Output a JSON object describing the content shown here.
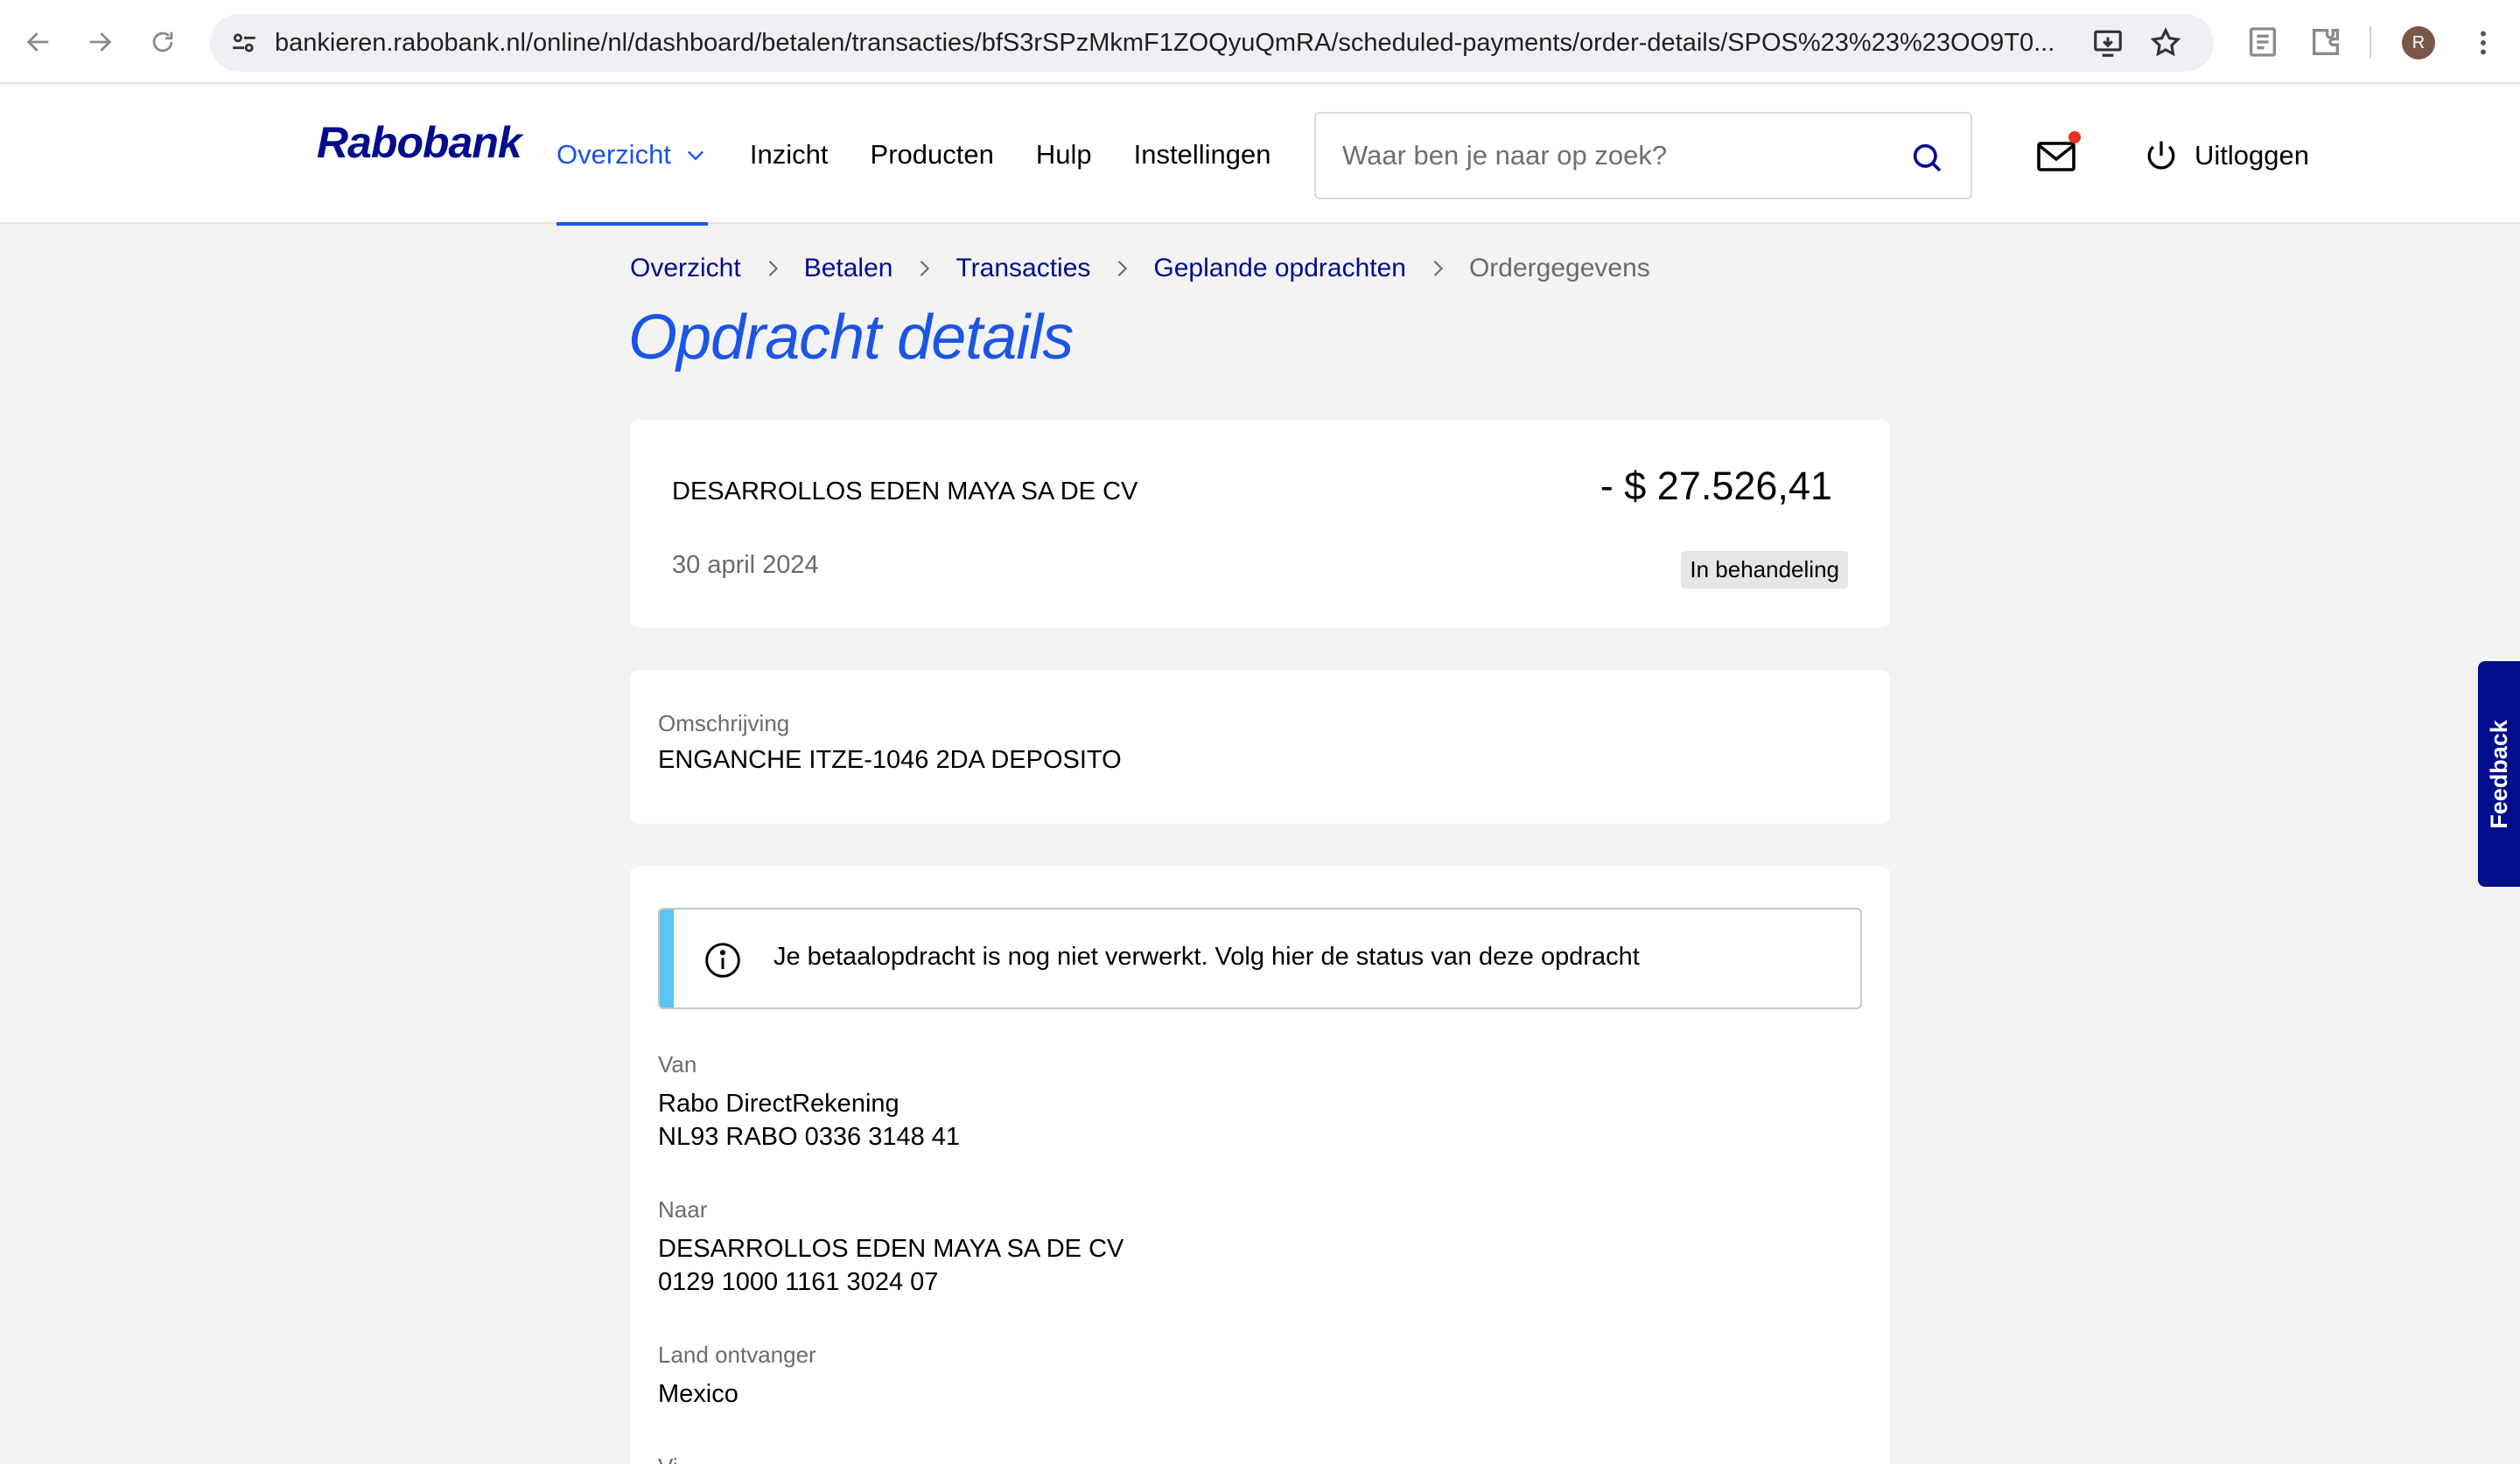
{
  "browser": {
    "url": "bankieren.rabobank.nl/online/nl/dashboard/betalen/transacties/bfS3rSPzMkmF1ZOQyuQmRA/scheduled-payments/order-details/SPOS%23%23%23OO9T0...",
    "profile_initial": "R"
  },
  "header": {
    "logo": "Rabobank",
    "nav": [
      {
        "label": "Overzicht",
        "active": true
      },
      {
        "label": "Inzicht"
      },
      {
        "label": "Producten"
      },
      {
        "label": "Hulp"
      },
      {
        "label": "Instellingen"
      }
    ],
    "search_placeholder": "Waar ben je naar op zoek?",
    "logout_label": "Uitloggen"
  },
  "breadcrumb": [
    "Overzicht",
    "Betalen",
    "Transacties",
    "Geplande opdrachten",
    "Ordergegevens"
  ],
  "title": "Opdracht details",
  "summary": {
    "payee": "DESARROLLOS EDEN MAYA SA DE CV",
    "amount": "- $ 27.526,41",
    "date": "30 april 2024",
    "status": "In behandeling"
  },
  "description": {
    "label": "Omschrijving",
    "value": "ENGANCHE ITZE-1046 2DA DEPOSITO"
  },
  "details": {
    "notice": "Je betaalopdracht is nog niet verwerkt. Volg hier de status van deze opdracht",
    "from": {
      "label": "Van",
      "account_name": "Rabo DirectRekening",
      "iban": "NL93 RABO 0336 3148 41"
    },
    "to": {
      "label": "Naar",
      "name": "DESARROLLOS EDEN MAYA SA DE CV",
      "account": "0129 1000 1161 3024 07"
    },
    "country": {
      "label": "Land ontvanger",
      "value": "Mexico"
    },
    "next_label_partial": "Vi"
  },
  "feedback_label": "Feedback",
  "colors": {
    "brand_navy": "#000d8c",
    "accent_blue": "#1b55e6",
    "notice_bar": "#5bc4f1",
    "page_bg": "#f3f3f3"
  }
}
